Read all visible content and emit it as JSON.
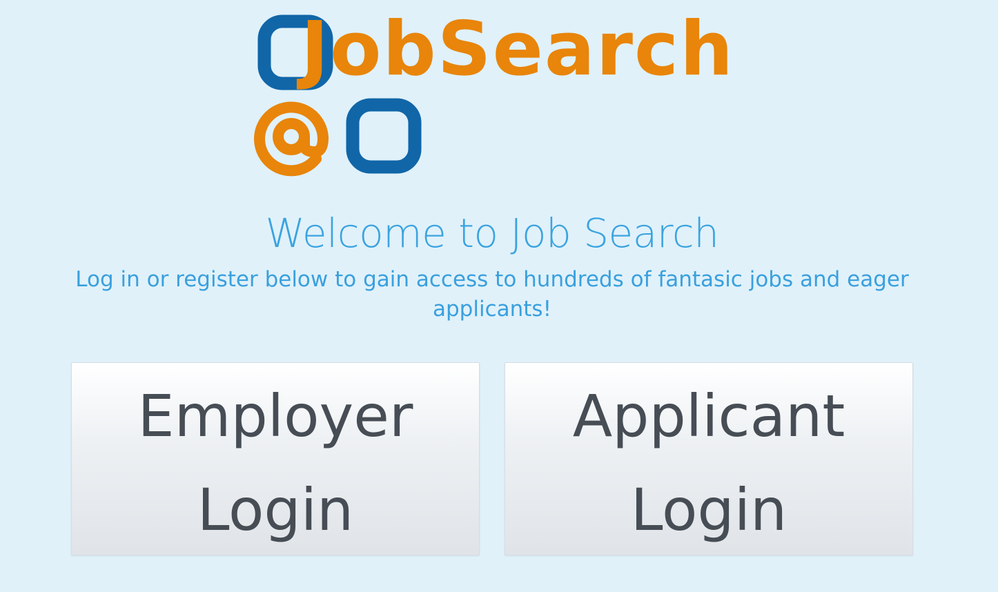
{
  "logo": {
    "text": "JobSearch",
    "at_symbol": "@",
    "colors": {
      "blue": "#1166a8",
      "orange": "#e8850a"
    }
  },
  "welcome": {
    "title": "Welcome to Job Search",
    "subtitle": "Log in or register below to gain access to hundreds of fantasic jobs and eager applicants!"
  },
  "buttons": {
    "employer_login": "Employer Login",
    "applicant_login": "Applicant Login"
  },
  "colors": {
    "background": "#e0f1fa",
    "heading": "#3ba3df",
    "button_text": "#474d55"
  }
}
